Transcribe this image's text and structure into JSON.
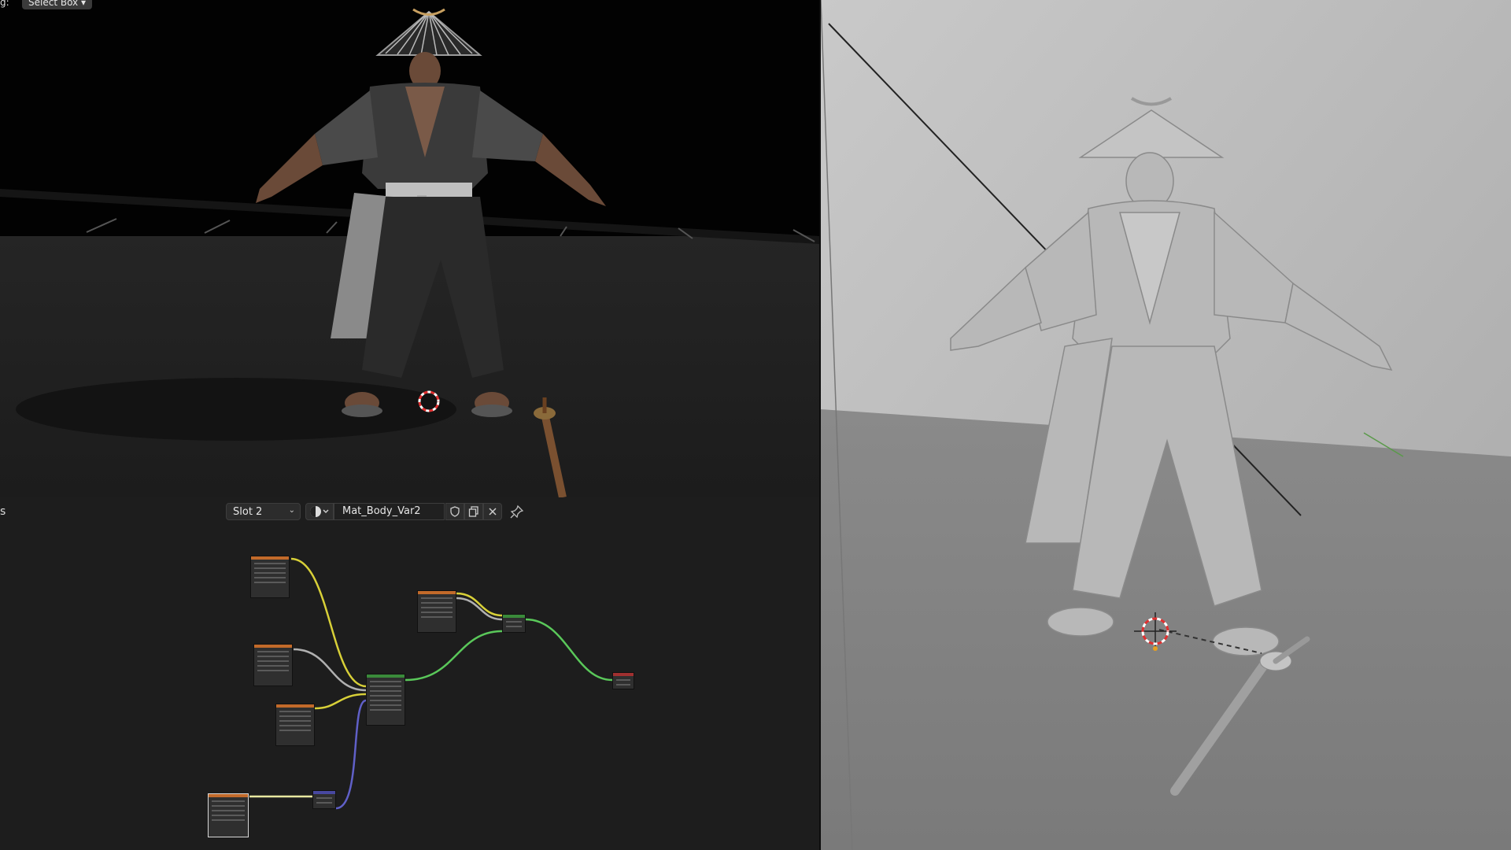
{
  "viewport_header": {
    "drag_label": "g:",
    "select_mode": "Select Box"
  },
  "node_editor": {
    "editor_label_trunc": "s",
    "slot": {
      "value": "Slot 2"
    },
    "material": {
      "name": "Mat_Body_Var2"
    }
  },
  "colors": {
    "image_texture_header": "#c26a2a",
    "principled_header": "#3a8a3a",
    "output_header": "#a03030",
    "normal_header": "#4848a0",
    "link_color": "#d8d038",
    "link_alpha": "#b0b0b0",
    "link_shader": "#5ac85a",
    "link_vector": "#6060c8"
  },
  "icons": [
    "sphere-material-icon",
    "shield-fake-user-icon",
    "duplicate-icon",
    "close-icon",
    "pin-icon",
    "3d-cursor-icon"
  ]
}
